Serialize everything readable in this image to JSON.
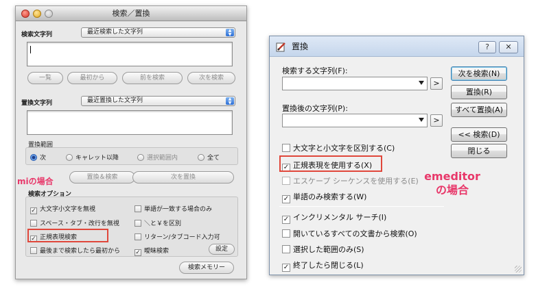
{
  "mi": {
    "title": "検索／置換",
    "search_label": "検索文字列",
    "search_popup": "最近検索した文字列",
    "btn_list": "一覧",
    "btn_from_start": "最初から",
    "btn_prev": "前を検索",
    "btn_next": "次を検索",
    "replace_label": "置換文字列",
    "replace_popup": "最近置換した文字列",
    "range_label": "置換範囲",
    "range_next": "次",
    "range_after_caret": "キャレット以降",
    "range_selection": "選択範囲内",
    "range_all": "全て",
    "btn_replace_search": "置換＆検索",
    "btn_replace_next": "次を置換",
    "options_label": "検索オプション",
    "opt_ignore_case": "大文字小文字を無視",
    "opt_whole_word": "単語が一致する場合のみ",
    "opt_ignore_space": "スペース・タブ・改行を無視",
    "opt_yen": "＼と￥を区別",
    "opt_regex": "正規表現検索",
    "opt_return_tab": "リターン/タブコード入力可",
    "opt_wrap": "最後まで検索したら最初から",
    "opt_fuzzy": "曖昧検索",
    "btn_settings": "設定",
    "btn_memory": "検索メモリー",
    "annotation": "miの場合"
  },
  "emeditor": {
    "title": "置換",
    "help_btn": "?",
    "close_btn": "✕",
    "find_label": "検索する文字列(F):",
    "replace_label": "置換後の文字列(P):",
    "arrow_btn": ">",
    "btn_find_next": "次を検索(N)",
    "btn_replace": "置換(R)",
    "btn_replace_all": "すべて置換(A)",
    "btn_find_prev": "<< 検索(D)",
    "btn_close": "閉じる",
    "opt_case": "大文字と小文字を区別する(C)",
    "opt_regex": "正規表現を使用する(X)",
    "opt_escape": "エスケープ シーケンスを使用する(E)",
    "opt_word": "単語のみ検索する(W)",
    "opt_incremental": "インクリメンタル サーチ(I)",
    "opt_all_docs": "開いているすべての文書から検索(O)",
    "opt_selection": "選択した範囲のみ(S)",
    "opt_close_after": "終了したら閉じる(L)",
    "annotation_line1": "emeditor",
    "annotation_line2": "の場合"
  },
  "colors": {
    "annotation": "#e8386a",
    "highlight_box": "#e0463a"
  }
}
